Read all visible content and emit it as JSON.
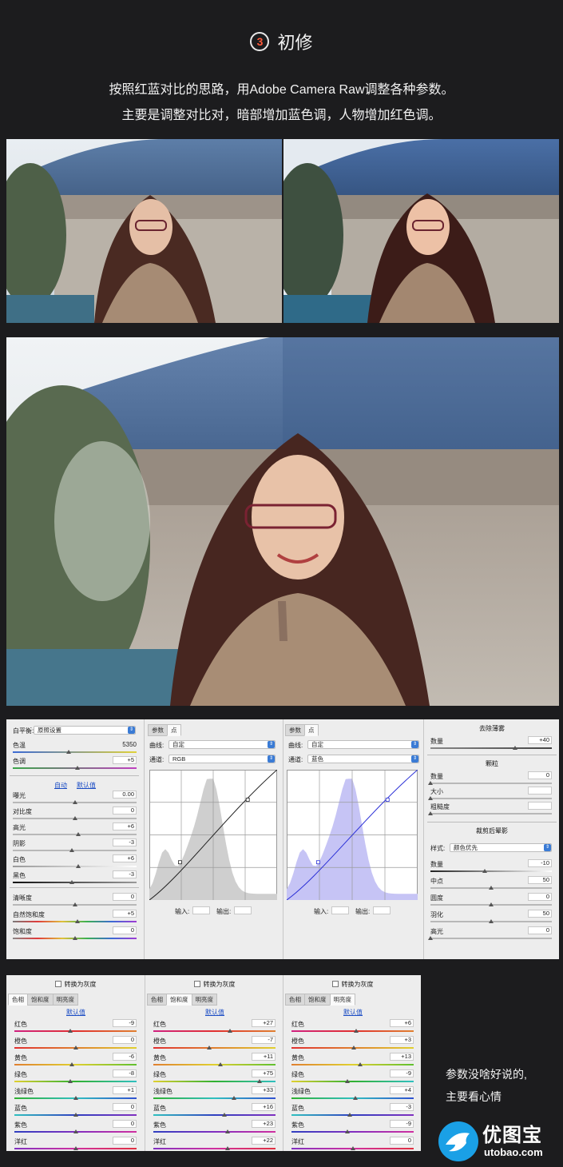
{
  "heading": {
    "number": "3",
    "title": "初修"
  },
  "intro": {
    "line1": "按照红蓝对比的思路，用Adobe Camera Raw调整各种参数。",
    "line2": "主要是调整对比对，暗部增加蓝色调，人物增加红色调。"
  },
  "basic": {
    "white_balance": {
      "label": "白平衡:",
      "value": "原照设置"
    },
    "temperature": {
      "label": "色温",
      "value": "5350",
      "level": 0.45
    },
    "tint": {
      "label": "色调",
      "value": "+5",
      "level": 0.52
    },
    "auto_link": "自动",
    "default_link": "默认值",
    "sliders": [
      {
        "label": "曝光",
        "value": "0.00",
        "level": 0.5
      },
      {
        "label": "对比度",
        "value": "0",
        "level": 0.5
      },
      {
        "label": "高光",
        "value": "+6",
        "level": 0.53
      },
      {
        "label": "阴影",
        "value": "-3",
        "level": 0.48
      },
      {
        "label": "白色",
        "value": "+6",
        "level": 0.53
      },
      {
        "label": "黑色",
        "value": "-3",
        "level": 0.48
      }
    ],
    "presence": [
      {
        "label": "清晰度",
        "value": "0",
        "level": 0.5
      },
      {
        "label": "自然饱和度",
        "value": "+5",
        "level": 0.52
      },
      {
        "label": "饱和度",
        "value": "0",
        "level": 0.5
      }
    ]
  },
  "curve_rgb": {
    "tabs": [
      "参数",
      "点"
    ],
    "curve_label": "曲线:",
    "curve_value": "自定",
    "channel_label": "通道:",
    "channel_value": "RGB",
    "input_label": "输入:",
    "output_label": "输出:",
    "histogram_color": "#cfcfcf",
    "line_color": "#222222"
  },
  "curve_blue": {
    "tabs": [
      "参数",
      "点"
    ],
    "curve_label": "曲线:",
    "curve_value": "自定",
    "channel_label": "通道:",
    "channel_value": "蓝色",
    "input_label": "输入:",
    "output_label": "输出:",
    "histogram_color": "#c6c4f5",
    "line_color": "#2a2fd6"
  },
  "effects": {
    "dehaze_title": "去除薄雾",
    "dehaze": {
      "label": "数量",
      "value": "+40",
      "level": 0.7
    },
    "grain_title": "颗粒",
    "grain": [
      {
        "label": "数量",
        "value": "0",
        "level": 0.0
      },
      {
        "label": "大小",
        "value": "",
        "level": 0.0
      },
      {
        "label": "粗糙度",
        "value": "",
        "level": 0.0
      }
    ],
    "vignette_title": "裁剪后晕影",
    "style_label": "样式:",
    "style_value": "颜色优先",
    "vignette": [
      {
        "label": "数量",
        "value": "-10",
        "level": 0.45
      },
      {
        "label": "中点",
        "value": "50",
        "level": 0.5
      },
      {
        "label": "圆度",
        "value": "0",
        "level": 0.5
      },
      {
        "label": "羽化",
        "value": "50",
        "level": 0.5
      },
      {
        "label": "高光",
        "value": "0",
        "level": 0.0
      }
    ]
  },
  "hsl": [
    {
      "gray_label": "转换为灰度",
      "tabs": [
        "色相",
        "饱和度",
        "明亮度"
      ],
      "active_tab": 0,
      "default_link": "默认值",
      "rows": [
        {
          "label": "红色",
          "value": "-9",
          "level": 0.46
        },
        {
          "label": "橙色",
          "value": "0",
          "level": 0.5
        },
        {
          "label": "黄色",
          "value": "-6",
          "level": 0.47
        },
        {
          "label": "绿色",
          "value": "-8",
          "level": 0.46
        },
        {
          "label": "浅绿色",
          "value": "+1",
          "level": 0.5
        },
        {
          "label": "蓝色",
          "value": "0",
          "level": 0.5
        },
        {
          "label": "紫色",
          "value": "0",
          "level": 0.5
        },
        {
          "label": "洋红",
          "value": "0",
          "level": 0.5
        }
      ]
    },
    {
      "gray_label": "转换为灰度",
      "tabs": [
        "色相",
        "饱和度",
        "明亮度"
      ],
      "active_tab": 1,
      "default_link": "默认值",
      "rows": [
        {
          "label": "红色",
          "value": "+27",
          "level": 0.63
        },
        {
          "label": "橙色",
          "value": "-7",
          "level": 0.46
        },
        {
          "label": "黄色",
          "value": "+11",
          "level": 0.55
        },
        {
          "label": "绿色",
          "value": "+75",
          "level": 0.87
        },
        {
          "label": "浅绿色",
          "value": "+33",
          "level": 0.66
        },
        {
          "label": "蓝色",
          "value": "+16",
          "level": 0.58
        },
        {
          "label": "紫色",
          "value": "+23",
          "level": 0.61
        },
        {
          "label": "洋红",
          "value": "+22",
          "level": 0.61
        }
      ]
    },
    {
      "gray_label": "转换为灰度",
      "tabs": [
        "色相",
        "饱和度",
        "明亮度"
      ],
      "active_tab": 2,
      "default_link": "默认值",
      "rows": [
        {
          "label": "红色",
          "value": "+6",
          "level": 0.53
        },
        {
          "label": "橙色",
          "value": "+3",
          "level": 0.51
        },
        {
          "label": "黄色",
          "value": "+13",
          "level": 0.56
        },
        {
          "label": "绿色",
          "value": "-9",
          "level": 0.46
        },
        {
          "label": "浅绿色",
          "value": "+4",
          "level": 0.52
        },
        {
          "label": "蓝色",
          "value": "-3",
          "level": 0.48
        },
        {
          "label": "紫色",
          "value": "-9",
          "level": 0.46
        },
        {
          "label": "洋红",
          "value": "0",
          "level": 0.5
        }
      ]
    }
  ],
  "side_note": {
    "line1": "参数没啥好说的,",
    "line2": "主要看心情"
  },
  "logo": {
    "cn": "优图宝",
    "url": "utobao.com"
  }
}
